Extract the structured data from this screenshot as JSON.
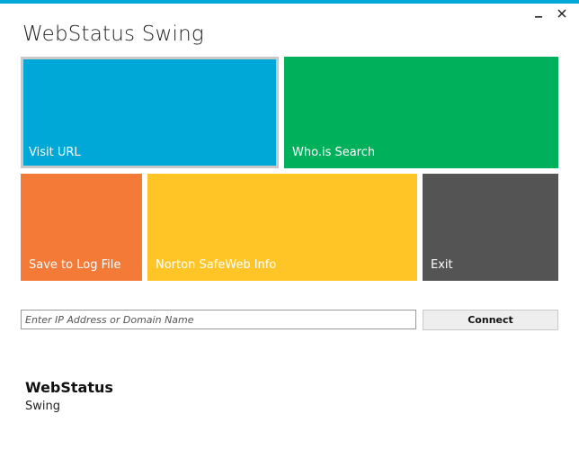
{
  "window": {
    "title": "WebStatus Swing",
    "controls": {
      "minimize_icon": "minimize-icon",
      "close_icon": "close-icon"
    }
  },
  "tiles": {
    "visit_url": {
      "label": "Visit URL",
      "color": "#00a8d8"
    },
    "whois_search": {
      "label": "Who.is Search",
      "color": "#00b05a"
    },
    "save_log": {
      "label": "Save to Log File",
      "color": "#f47a38"
    },
    "norton_info": {
      "label": "Norton SafeWeb Info",
      "color": "#ffc426"
    },
    "exit": {
      "label": "Exit",
      "color": "#545454"
    }
  },
  "address": {
    "value": "",
    "placeholder": "Enter IP Address or Domain Name"
  },
  "connect": {
    "label": "Connect"
  },
  "brand": {
    "name": "WebStatus",
    "subtitle": "Swing"
  },
  "accent_color": "#00a8d8"
}
